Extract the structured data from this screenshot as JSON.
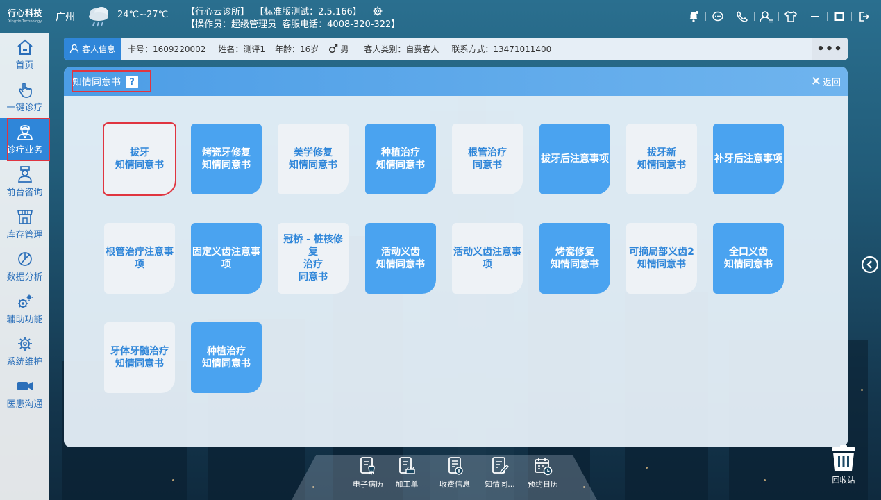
{
  "topbar": {
    "logo_main": "行心科技",
    "logo_sub": "Xingxin Technology",
    "city": "广州",
    "temperature": "24℃~27℃",
    "clinic_name": "【行心云诊所】",
    "version": "【标准版测试：2.5.166】",
    "operator": "【操作员：超级管理员",
    "service_phone": "客服电话：4008-320-322】"
  },
  "sidebar": {
    "items": [
      {
        "label": "首页",
        "icon": "home-icon"
      },
      {
        "label": "一键诊疗",
        "icon": "hand-pointer-icon"
      },
      {
        "label": "诊疗业务",
        "icon": "doctor-icon"
      },
      {
        "label": "前台咨询",
        "icon": "nurse-icon"
      },
      {
        "label": "库存管理",
        "icon": "store-icon"
      },
      {
        "label": "数据分析",
        "icon": "pie-chart-icon"
      },
      {
        "label": "辅助功能",
        "icon": "gears-icon"
      },
      {
        "label": "系统维护",
        "icon": "settings-icon"
      },
      {
        "label": "医患沟通",
        "icon": "video-camera-icon"
      }
    ]
  },
  "customer": {
    "tab_label": "客人信息",
    "card_no": "卡号：1609220002",
    "name": "姓名：测评1",
    "age": "年龄：16岁",
    "gender": "男",
    "category": "客人类别：自费客人",
    "contact": "联系方式：13471011400",
    "more_label": "•••"
  },
  "panel": {
    "title": "知情同意书",
    "help_label": "?",
    "back_label": "返回",
    "cards": [
      {
        "text": "拔牙\n知情同意书",
        "style": "light",
        "selected": true
      },
      {
        "text": "烤瓷牙修复\n知情同意书",
        "style": "blue"
      },
      {
        "text": "美学修复\n知情同意书",
        "style": "light"
      },
      {
        "text": "种植治疗\n知情同意书",
        "style": "blue"
      },
      {
        "text": "根管治疗\n同意书",
        "style": "light"
      },
      {
        "text": "拔牙后注意事项",
        "style": "blue"
      },
      {
        "text": "拔牙新\n知情同意书",
        "style": "light"
      },
      {
        "text": "补牙后注意事项",
        "style": "blue"
      },
      {
        "text": "根管治疗注意事\n项",
        "style": "light"
      },
      {
        "text": "固定义齿注意事\n项",
        "style": "blue"
      },
      {
        "text": "冠桥 - 桩核修复\n治疗\n同意书",
        "style": "light"
      },
      {
        "text": "活动义齿\n知情同意书",
        "style": "blue"
      },
      {
        "text": "活动义齿注意事\n项",
        "style": "light"
      },
      {
        "text": "烤瓷修复\n知情同意书",
        "style": "blue"
      },
      {
        "text": "可摘局部义齿2\n知情同意书",
        "style": "light"
      },
      {
        "text": "全口义齿\n知情同意书",
        "style": "blue"
      },
      {
        "text": "牙体牙髓治疗\n知情同意书",
        "style": "light"
      },
      {
        "text": "种植治疗\n知情同意书",
        "style": "blue"
      }
    ]
  },
  "dock": {
    "items": [
      {
        "label": "电子病历"
      },
      {
        "label": "加工单"
      },
      {
        "label": "收费信息"
      },
      {
        "label": "知情同..."
      },
      {
        "label": "预约日历"
      }
    ]
  },
  "recycle": {
    "label": "回收站"
  },
  "colors": {
    "accent": "#2f86d9",
    "highlight": "#e03540",
    "card_blue": "#4aa3f0",
    "card_light": "#eef2f6"
  }
}
